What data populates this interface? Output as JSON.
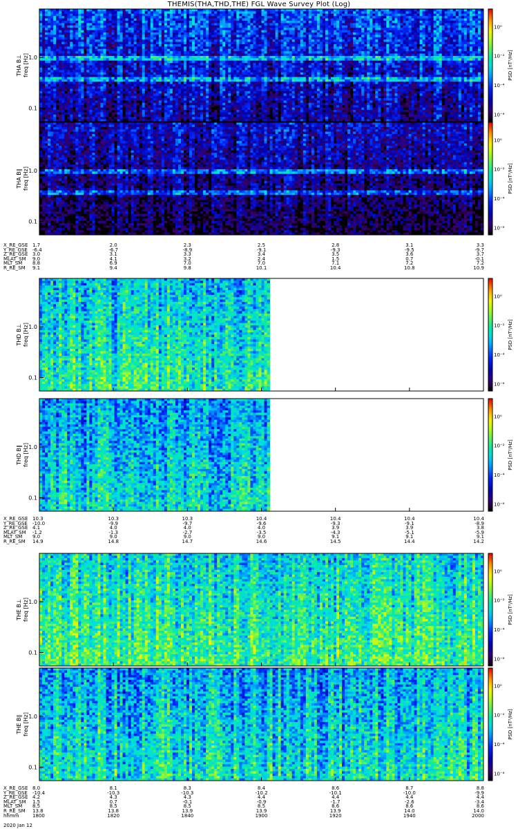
{
  "title": "THEMIS(THA,THD,THE) FGL Wave Survey Plot (Log)",
  "date_label": "2020 Jan 12",
  "colorbar_label": "PSD [nT²/Hz]",
  "colorbar_ticks": [
    "10⁰",
    "10⁻²",
    "10⁻⁴",
    "10⁻⁶"
  ],
  "chart_data": [
    {
      "type": "heatmap",
      "probe": "THA",
      "panels": [
        {
          "name": "THA B⊥",
          "ylabel": "THA B⊥",
          "ysub": "freq [Hz]",
          "yscale": "log",
          "yticks": [
            "1.0",
            "0.1"
          ],
          "coverage": 1.0,
          "color_level": 0.32,
          "variability": 0.22,
          "bands": true
        },
        {
          "name": "THA B∥",
          "ylabel": "THA B∥",
          "ysub": "freq [Hz]",
          "yscale": "log",
          "yticks": [
            "1.0",
            "0.1"
          ],
          "coverage": 1.0,
          "color_level": 0.22,
          "variability": 0.18,
          "bands": true
        }
      ],
      "ephemeris": {
        "rows": [
          "X_RE_GSE",
          "Y_RE_GSE",
          "Z_RE_GSE",
          "MLAT_SM",
          "MLT_SM",
          "R_RE_SM"
        ],
        "columns": [
          [
            "1.7",
            "-6.4",
            "3.0",
            "9.0",
            "8.8",
            "9.1"
          ],
          [
            "2.0",
            "-6.7",
            "3.1",
            "4.1",
            "6.9",
            "9.4"
          ],
          [
            "2.3",
            "-8.9",
            "3.3",
            "3.2",
            "7.0",
            "9.8"
          ],
          [
            "2.5",
            "-9.1",
            "3.4",
            "2.4",
            "7.0",
            "10.1"
          ],
          [
            "2.8",
            "-9.3",
            "3.5",
            "1.5",
            "7.1",
            "10.4"
          ],
          [
            "3.1",
            "-9.5",
            "3.6",
            "0.7",
            "7.2",
            "10.8"
          ],
          [
            "3.3",
            "-9.7",
            "3.7",
            "-0.1",
            "7.2",
            "10.9"
          ]
        ]
      }
    },
    {
      "type": "heatmap",
      "probe": "THD",
      "panels": [
        {
          "name": "THD B⊥",
          "ylabel": "THD B⊥",
          "ysub": "freq [Hz]",
          "yscale": "log",
          "yticks": [
            "1.0",
            "0.1"
          ],
          "coverage": 0.52,
          "color_level": 0.52,
          "variability": 0.2,
          "bands": false
        },
        {
          "name": "THD B∥",
          "ylabel": "THD B∥",
          "ysub": "freq [Hz]",
          "yscale": "log",
          "yticks": [
            "1.0",
            "0.1"
          ],
          "coverage": 0.52,
          "color_level": 0.46,
          "variability": 0.2,
          "bands": false
        }
      ],
      "ephemeris": {
        "rows": [
          "X_RE_GSE",
          "Y_RE_GSE",
          "Z_RE_GSE",
          "MLAT_SM",
          "MLT_SM",
          "R_RE_SM"
        ],
        "columns": [
          [
            "10.3",
            "-10.0",
            "4.1",
            "-1.2",
            "9.0",
            "14.9"
          ],
          [
            "10.3",
            "-9.9",
            "4.0",
            "-1.3",
            "9.0",
            "14.8"
          ],
          [
            "10.3",
            "-9.7",
            "4.0",
            "-2.7",
            "9.0",
            "14.7"
          ],
          [
            "10.4",
            "-9.6",
            "4.0",
            "-3.5",
            "9.0",
            "14.6"
          ],
          [
            "10.4",
            "-9.3",
            "3.9",
            "-4.3",
            "9.1",
            "14.5"
          ],
          [
            "10.4",
            "-9.1",
            "3.9",
            "-5.1",
            "9.1",
            "14.4"
          ],
          [
            "10.4",
            "-8.9",
            "3.8",
            "-5.9",
            "9.1",
            "14.2"
          ]
        ]
      }
    },
    {
      "type": "heatmap",
      "probe": "THE",
      "panels": [
        {
          "name": "THE B⊥",
          "ylabel": "THE B⊥",
          "ysub": "freq [Hz]",
          "yscale": "log",
          "yticks": [
            "1.0",
            "0.1"
          ],
          "coverage": 1.0,
          "color_level": 0.56,
          "variability": 0.2,
          "bands": false
        },
        {
          "name": "THE B∥",
          "ylabel": "THE B∥",
          "ysub": "freq [Hz]",
          "yscale": "log",
          "yticks": [
            "1.0",
            "0.1"
          ],
          "coverage": 1.0,
          "color_level": 0.48,
          "variability": 0.22,
          "bands": false
        }
      ],
      "ephemeris": {
        "rows": [
          "X_RE_GSE",
          "Y_RE_GSE",
          "Z_RE_GSE",
          "MLAT_SM",
          "MLT_SM",
          "R_RE_SM",
          "hhmm"
        ],
        "columns": [
          [
            "8.0",
            "-10.4",
            "4.2",
            "1.5",
            "8.5",
            "13.8",
            "1800"
          ],
          [
            "8.1",
            "-10.3",
            "4.3",
            "0.7",
            "8.5",
            "13.8",
            "1820"
          ],
          [
            "8.3",
            "-10.3",
            "4.3",
            "-0.1",
            "8.5",
            "13.9",
            "1840"
          ],
          [
            "8.4",
            "-10.2",
            "4.4",
            "-0.9",
            "8.5",
            "13.9",
            "1900"
          ],
          [
            "8.6",
            "-10.1",
            "4.4",
            "-1.7",
            "8.6",
            "13.9",
            "1920"
          ],
          [
            "8.7",
            "-10.0",
            "4.4",
            "-2.6",
            "8.6",
            "14.0",
            "1940"
          ],
          [
            "8.8",
            "-9.9",
            "4.4",
            "-3.4",
            "8.6",
            "14.0",
            "2000"
          ]
        ]
      }
    }
  ]
}
